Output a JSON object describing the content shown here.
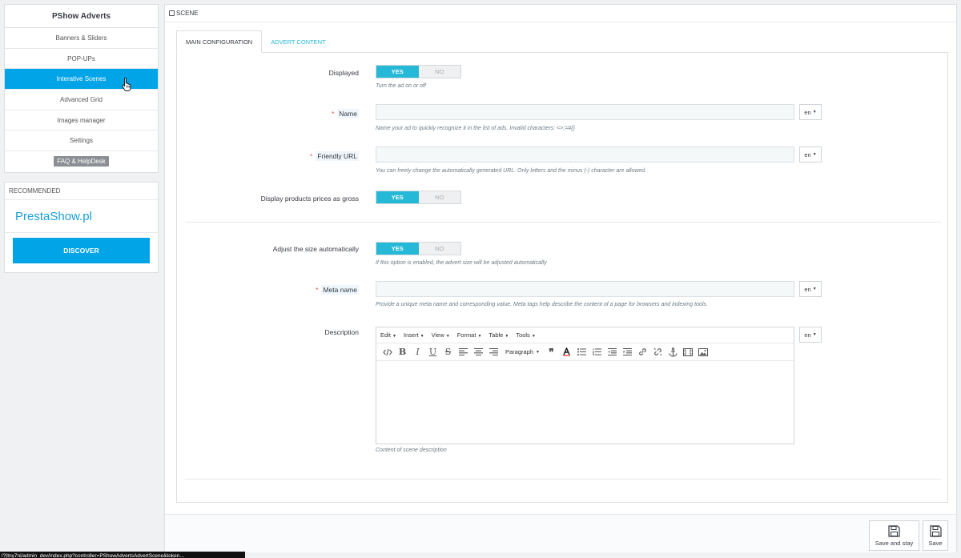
{
  "sidebar": {
    "title": "PShow Adverts",
    "items": [
      {
        "label": "Banners & Sliders"
      },
      {
        "label": "POP-UPs"
      },
      {
        "label": "Interative Scenes"
      },
      {
        "label": "Advanced Grid"
      },
      {
        "label": "Images manager"
      },
      {
        "label": "Settings"
      },
      {
        "label": "FAQ & HelpDesk"
      }
    ],
    "active_index": 2
  },
  "recommended": {
    "title": "RECOMMENDED",
    "brand": "PrestaShow.pl",
    "discover_label": "DISCOVER"
  },
  "panel": {
    "title": "SCENE",
    "tabs": [
      {
        "label": "MAIN CONFIGURATION",
        "active": true
      },
      {
        "label": "ADVERT CONTENT",
        "active": false
      }
    ]
  },
  "switch_labels": {
    "yes": "YES",
    "no": "NO"
  },
  "form": {
    "displayed": {
      "label": "Displayed",
      "value": "YES",
      "hint": "Turn the ad on or off"
    },
    "name": {
      "label": "Name",
      "value": "",
      "lang": "en",
      "hint": "Name your ad to quickly recognize it in the list of ads. Invalid characters: <>;=#{}"
    },
    "friendly_url": {
      "label": "Friendly URL",
      "value": "",
      "lang": "en",
      "hint": "You can freely change the automatically generated URL. Only letters and the minus (-) character are allowed."
    },
    "prices_gross": {
      "label": "Display products prices as gross",
      "value": "YES"
    },
    "adjust_size": {
      "label": "Adjust the size automatically",
      "value": "YES",
      "hint": "If this option is enabled, the advert size will be adjusted automatically"
    },
    "meta_name": {
      "label": "Meta name",
      "value": "",
      "lang": "en",
      "hint": "Provide a unique meta name and corresponding value. Meta tags help describe the content of a page for browsers and indexing tools."
    },
    "description": {
      "label": "Description",
      "lang": "en",
      "hint": "Content of scene description"
    }
  },
  "required_mark": "*",
  "editor": {
    "menus": [
      "Edit",
      "Insert",
      "View",
      "Format",
      "Table",
      "Tools"
    ],
    "paragraph_label": "Paragraph"
  },
  "footer": {
    "save_and_stay": "Save and stay",
    "save": "Save"
  },
  "status_url": "l?{tny7ni/admin_dev/index.php?controller=PShowAdvertsAdvertScene&token..."
}
